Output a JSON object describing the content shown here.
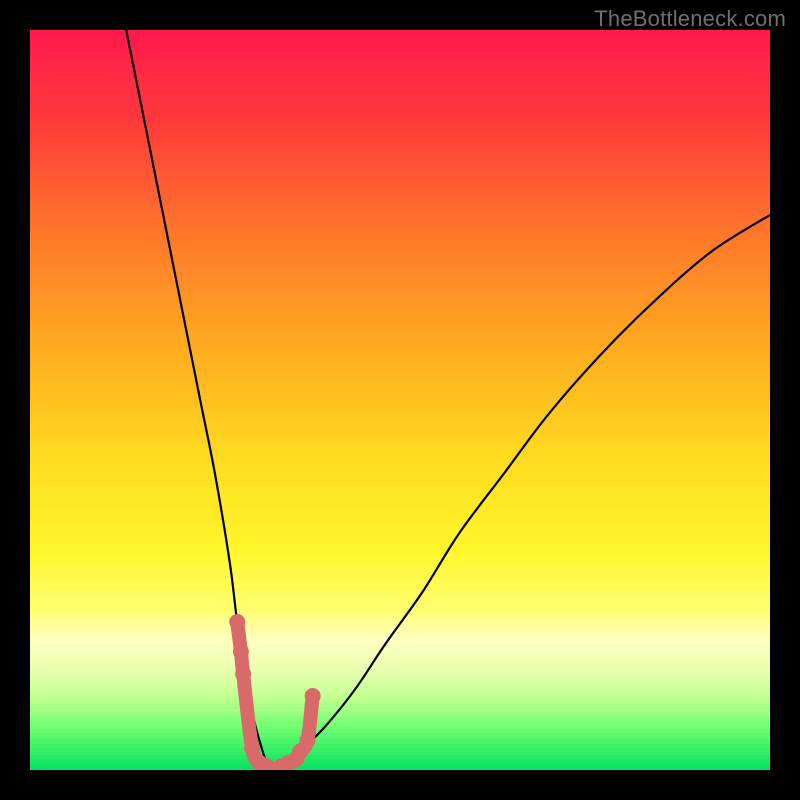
{
  "watermark": {
    "text": "TheBottleneck.com"
  },
  "chart_data": {
    "type": "line",
    "title": "",
    "xlabel": "",
    "ylabel": "",
    "xlim": [
      0,
      100
    ],
    "ylim": [
      0,
      100
    ],
    "grid": false,
    "optimum_x": 33,
    "background_gradient_notes": "vertical heatmap from red (top, ~100) to green (bottom, ~0); watermark top-right",
    "background_gradient": [
      {
        "y_pct": 0,
        "color": "#ff1a4d"
      },
      {
        "y_pct": 12,
        "color": "#ff3a3a"
      },
      {
        "y_pct": 28,
        "color": "#ff7a2a"
      },
      {
        "y_pct": 44,
        "color": "#ffb020"
      },
      {
        "y_pct": 58,
        "color": "#ffdc20"
      },
      {
        "y_pct": 70,
        "color": "#fff62a"
      },
      {
        "y_pct": 78,
        "color": "#ffff70"
      },
      {
        "y_pct": 82,
        "color": "#ffffc0"
      },
      {
        "y_pct": 86,
        "color": "#eaffb0"
      },
      {
        "y_pct": 90,
        "color": "#c0ff90"
      },
      {
        "y_pct": 94,
        "color": "#70ff70"
      },
      {
        "y_pct": 100,
        "color": "#00e060"
      }
    ],
    "series": [
      {
        "name": "bottleneck-curve-left",
        "stroke": "#000000",
        "x": [
          13,
          15,
          17,
          19,
          21,
          23,
          25,
          27,
          28,
          29,
          30,
          31,
          32,
          33
        ],
        "y": [
          100,
          90,
          80,
          70,
          60,
          50,
          40,
          28,
          20,
          14,
          8,
          4,
          1,
          0
        ]
      },
      {
        "name": "bottleneck-curve-right",
        "stroke": "#000000",
        "x": [
          33,
          35,
          37,
          40,
          44,
          48,
          53,
          58,
          64,
          70,
          77,
          84,
          92,
          100
        ],
        "y": [
          0,
          1,
          3,
          6,
          11,
          17,
          24,
          32,
          40,
          48,
          56,
          63,
          70,
          75
        ]
      },
      {
        "name": "sample-markers",
        "stroke": "#d86a6a",
        "marker": "circle",
        "marker_r": 8,
        "x": [
          28.0,
          28.5,
          28.8,
          30.0,
          31.0,
          32.0,
          33.0,
          34.0,
          35.0,
          36.0,
          36.5,
          37.5,
          38.2
        ],
        "y": [
          20.0,
          16.0,
          13.0,
          3.0,
          1.0,
          0.5,
          0.0,
          0.5,
          1.0,
          1.5,
          2.5,
          4.0,
          10.0
        ]
      }
    ]
  }
}
